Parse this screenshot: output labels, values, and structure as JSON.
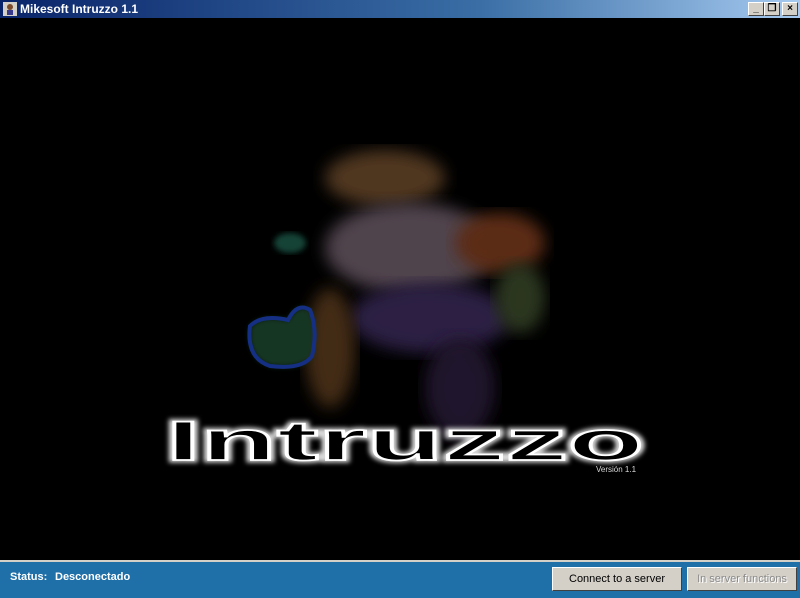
{
  "window": {
    "title": "Mikesoft Intruzzo 1.1",
    "controls": {
      "minimize": "_",
      "maximize": "❐",
      "close": "×"
    }
  },
  "splash": {
    "logo_text": "Intruzzo",
    "version": "Versión 1.1",
    "icon": "hooded-burglar-figure"
  },
  "status": {
    "label": "Status:",
    "value": "Desconectado"
  },
  "buttons": {
    "connect": "Connect to a server",
    "server_functions": "In server functions"
  },
  "colors": {
    "titlebar_start": "#0a246a",
    "statusbar": "#1f6fa8",
    "button_face": "#d4d0c8",
    "disabled_text": "#8a8a8a"
  }
}
